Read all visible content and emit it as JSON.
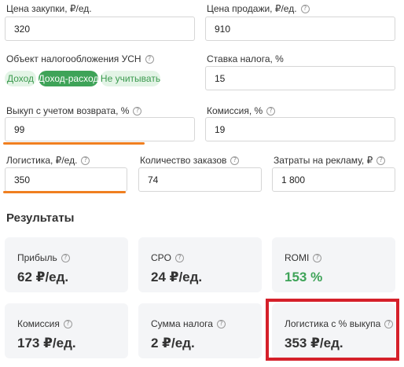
{
  "fields": {
    "purchase_price": {
      "label": "Цена закупки, ₽/ед.",
      "value": "320"
    },
    "sale_price": {
      "label": "Цена продажи, ₽/ед.",
      "value": "910"
    },
    "tax_object": {
      "label": "Объект налогообложения УСН",
      "options": [
        "Доход",
        "Доход-расход",
        "Не учитывать"
      ],
      "selected": "Доход-расход"
    },
    "tax_rate": {
      "label": "Ставка налога, %",
      "value": "15"
    },
    "buyout": {
      "label": "Выкуп с учетом возврата, %",
      "value": "99"
    },
    "commission": {
      "label": "Комиссия, %",
      "value": "19"
    },
    "logistics": {
      "label": "Логистика, ₽/ед.",
      "value": "350"
    },
    "orders": {
      "label": "Количество заказов",
      "value": "74"
    },
    "ads": {
      "label": "Затраты на рекламу, ₽",
      "value": "1 800"
    }
  },
  "results": {
    "title": "Результаты",
    "cards": [
      {
        "label": "Прибыль",
        "value": "62 ₽/ед."
      },
      {
        "label": "CPO",
        "value": "24 ₽/ед."
      },
      {
        "label": "ROMI",
        "value": "153 %"
      },
      {
        "label": "Комиссия",
        "value": "173 ₽/ед."
      },
      {
        "label": "Сумма налога",
        "value": "2 ₽/ед."
      },
      {
        "label": "Логистика с % выкупа",
        "value": "353 ₽/ед."
      }
    ]
  },
  "help_glyph": "?",
  "colors": {
    "accent_green": "#3ea358",
    "underline_orange": "#f07f20",
    "highlight_red": "#d5202a"
  }
}
